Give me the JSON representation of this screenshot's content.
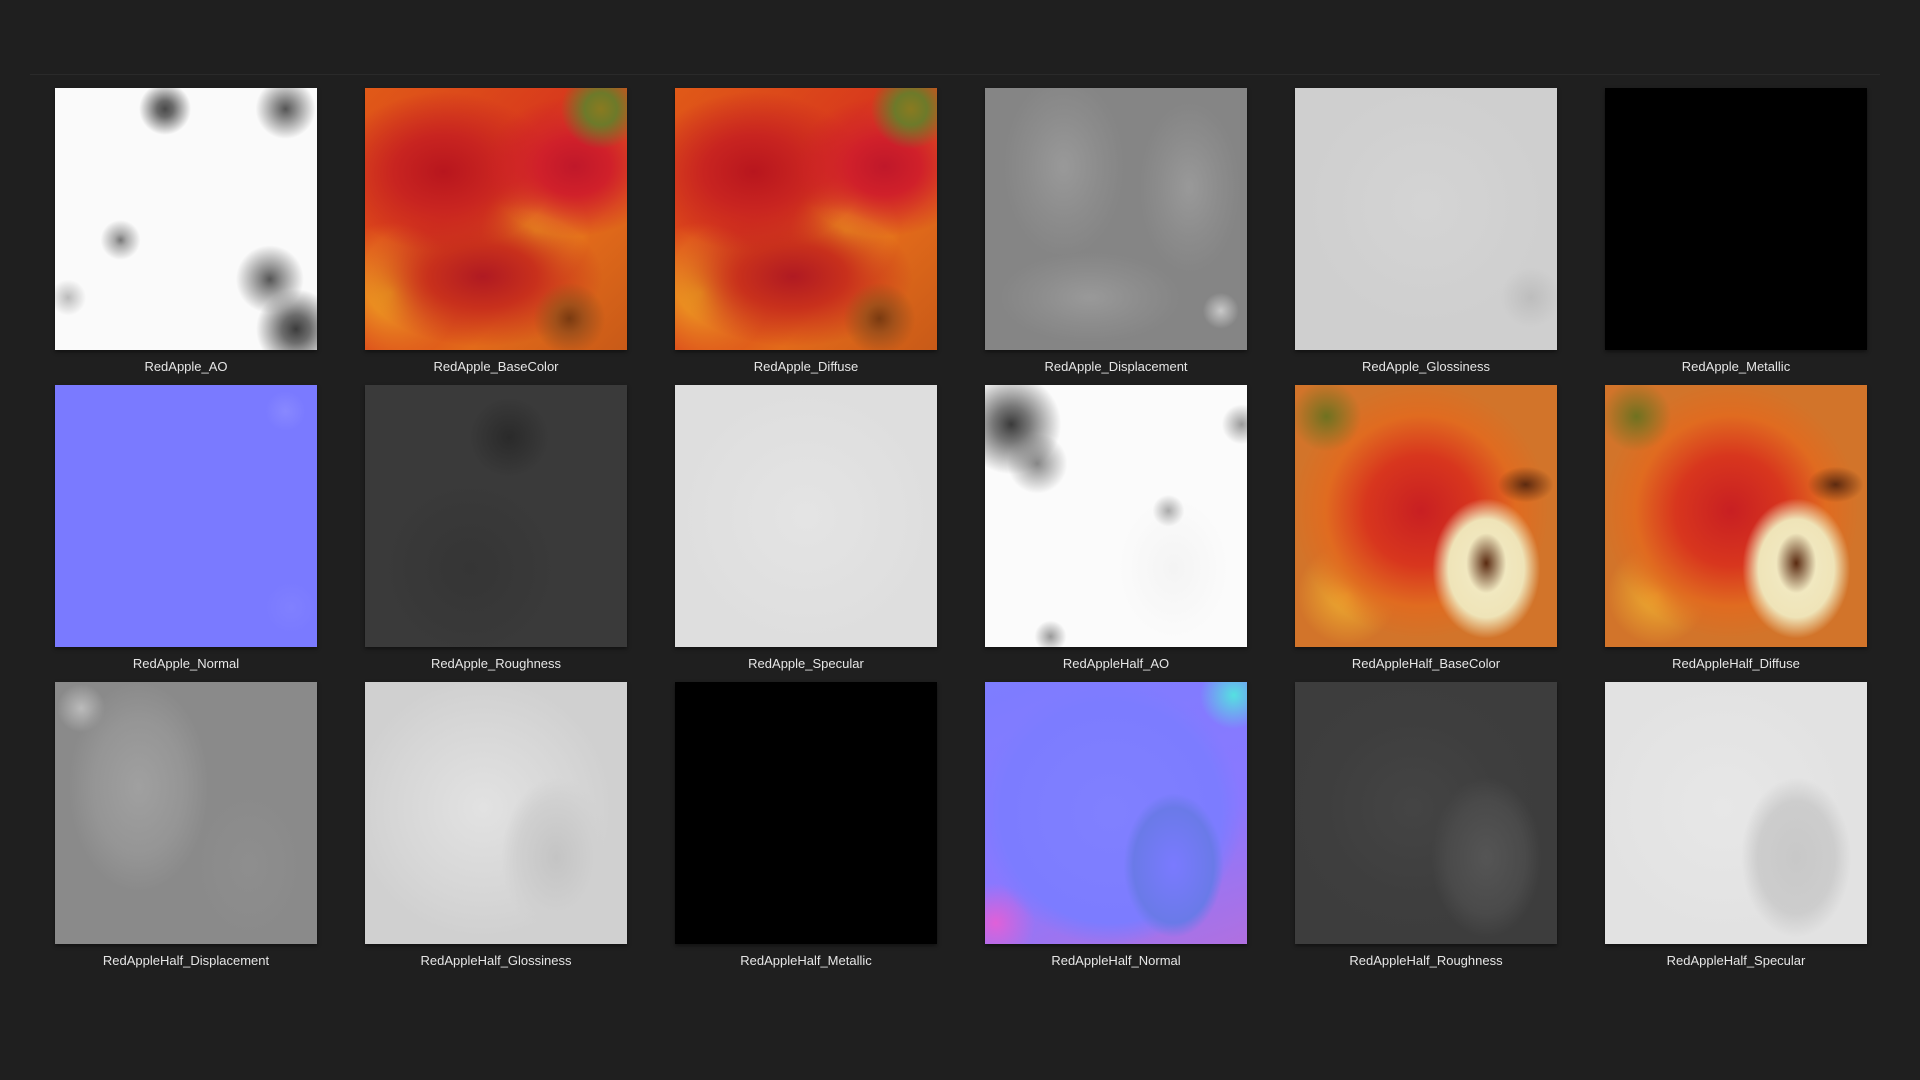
{
  "viewer": {
    "items": [
      {
        "label": "RedApple_AO",
        "texture": "ao"
      },
      {
        "label": "RedApple_BaseColor",
        "texture": "basecolor"
      },
      {
        "label": "RedApple_Diffuse",
        "texture": "basecolor"
      },
      {
        "label": "RedApple_Displacement",
        "texture": "displacement"
      },
      {
        "label": "RedApple_Glossiness",
        "texture": "gloss"
      },
      {
        "label": "RedApple_Metallic",
        "texture": "black"
      },
      {
        "label": "RedApple_Normal",
        "texture": "normal"
      },
      {
        "label": "RedApple_Roughness",
        "texture": "roughness"
      },
      {
        "label": "RedApple_Specular",
        "texture": "specular"
      },
      {
        "label": "RedAppleHalf_AO",
        "texture": "half-ao"
      },
      {
        "label": "RedAppleHalf_BaseColor",
        "texture": "half-base"
      },
      {
        "label": "RedAppleHalf_Diffuse",
        "texture": "half-base"
      },
      {
        "label": "RedAppleHalf_Displacement",
        "texture": "half-disp"
      },
      {
        "label": "RedAppleHalf_Glossiness",
        "texture": "half-gloss"
      },
      {
        "label": "RedAppleHalf_Metallic",
        "texture": "black"
      },
      {
        "label": "RedAppleHalf_Normal",
        "texture": "half-normal"
      },
      {
        "label": "RedAppleHalf_Roughness",
        "texture": "half-rough"
      },
      {
        "label": "RedAppleHalf_Specular",
        "texture": "half-spec"
      }
    ]
  },
  "colors": {
    "background": "#1f1f1f",
    "caption_text": "#e6e6e6"
  }
}
